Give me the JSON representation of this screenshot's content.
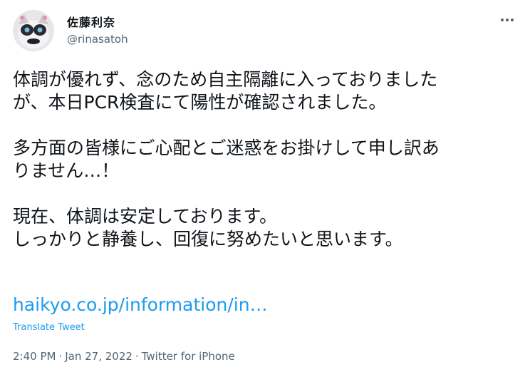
{
  "author": {
    "display_name": "佐藤利奈",
    "handle": "@rinasatoh",
    "avatar": "profile-avatar"
  },
  "menu": {
    "icon": "more-horizontal-icon"
  },
  "tweet": {
    "lines": [
      "体調が優れず、念のため自主隔離に入っておりました",
      "が、本日PCR検査にて陽性が確認されました。",
      "",
      "多方面の皆様にご心配とご迷惑をお掛けして申し訳あ",
      "りません…！",
      "",
      "現在、体調は安定しております。",
      "しっかりと静養し、回復に努めたいと思います。"
    ],
    "link": "haikyo.co.jp/information/in…",
    "translate_label": "Translate Tweet"
  },
  "meta": {
    "time": "2:40 PM",
    "separator": "·",
    "date": "Jan 27, 2022",
    "source": "Twitter for iPhone"
  },
  "colors": {
    "link": "#1d9bf0",
    "secondary_text": "#536471",
    "primary_text": "#0f1419"
  }
}
